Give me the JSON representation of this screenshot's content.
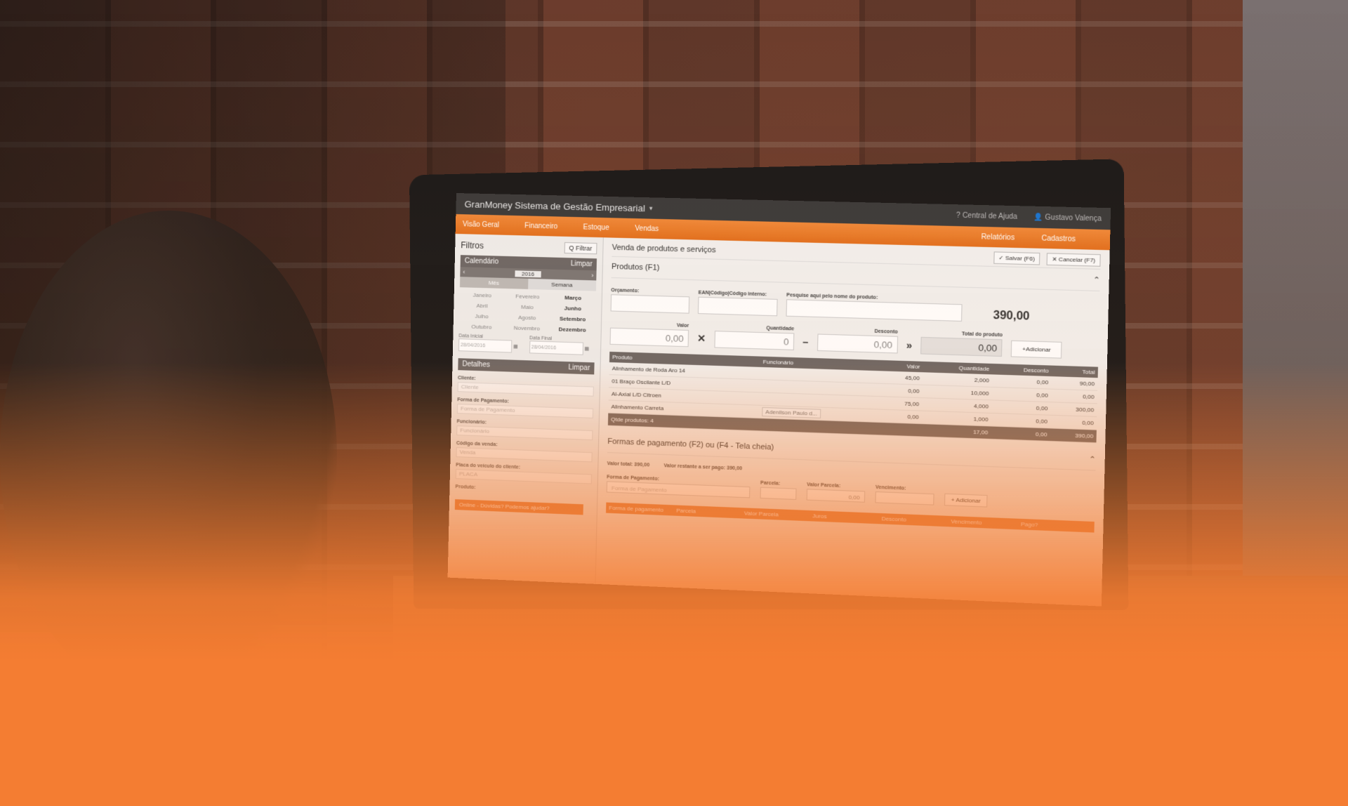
{
  "app": {
    "title": "GranMoney Sistema de Gestão Empresarial",
    "help": "? Central de Ajuda",
    "user": "Gustavo Valença"
  },
  "nav": {
    "items": [
      "Visão Geral",
      "Financeiro",
      "Estoque",
      "Vendas"
    ],
    "right_items": [
      "Relatórios",
      "Cadastros"
    ]
  },
  "sidebar": {
    "title": "Filtros",
    "filter_button": "Q Filtrar",
    "calendar": {
      "title": "Calendário",
      "clear": "Limpar",
      "year": "2016",
      "tabs": [
        "Mês",
        "Semana"
      ],
      "months": [
        "Janeiro",
        "Fevereiro",
        "Março",
        "Abril",
        "Maio",
        "Junho",
        "Julho",
        "Agosto",
        "Setembro",
        "Outubro",
        "Novembro",
        "Dezembro"
      ],
      "current_month": "Março",
      "date_start_label": "Data Inicial",
      "date_start": "28/04/2016",
      "date_end_label": "Data Final",
      "date_end": "28/04/2016"
    },
    "details": {
      "title": "Detalhes",
      "clear": "Limpar",
      "fields": [
        {
          "label": "Cliente:",
          "placeholder": "Cliente"
        },
        {
          "label": "Forma de Pagamento:",
          "placeholder": "Forma de Pagamento"
        },
        {
          "label": "Funcionário:",
          "placeholder": "Funcionário"
        },
        {
          "label": "Código da venda:",
          "placeholder": "Venda"
        },
        {
          "label": "Placa do veículo do cliente:",
          "placeholder": "PLACA"
        },
        {
          "label": "Produto:",
          "placeholder": ""
        }
      ]
    },
    "chat": "Online - Dúvidas? Podemos ajudar?"
  },
  "main": {
    "title": "Venda de produtos e serviços",
    "save": "✓ Salvar (F6)",
    "cancel": "✕ Cancelar (F7)",
    "products_section": "Produtos (F1)",
    "labels": {
      "orcamento": "Orçamento:",
      "ean": "EAN|Código|Código interno:",
      "search": "Pesquise aqui pelo nome do produto:",
      "valor": "Valor",
      "quantidade": "Quantidade",
      "desconto": "Desconto",
      "total_produto": "Total do produto"
    },
    "grand_total": "390,00",
    "inputs": {
      "valor": "0,00",
      "quantidade": "0",
      "desconto": "0,00",
      "total": "0,00"
    },
    "add_button": "+Adicionar",
    "table": {
      "headers": [
        "Produto",
        "Funcionário",
        "Valor",
        "Quantidade",
        "Desconto",
        "Total"
      ],
      "rows": [
        {
          "produto": "Alinhamento de Roda Aro 14",
          "func": "",
          "valor": "45,00",
          "qtd": "2,000",
          "desc": "0,00",
          "total": "90,00"
        },
        {
          "produto": "01 Braço Oscilante L/D",
          "func": "",
          "valor": "0,00",
          "qtd": "10,000",
          "desc": "0,00",
          "total": "0,00"
        },
        {
          "produto": "Al-Axial L/D Citroen",
          "func": "",
          "valor": "75,00",
          "qtd": "4,000",
          "desc": "0,00",
          "total": "300,00"
        },
        {
          "produto": "Alinhamento Carreta",
          "func": "Adenilson Paulo d...",
          "valor": "0,00",
          "qtd": "1,000",
          "desc": "0,00",
          "total": "0,00"
        }
      ],
      "footer": {
        "label": "Qtde produtos: 4",
        "qtd": "17,00",
        "desc": "0,00",
        "total": "390,00"
      }
    },
    "payments": {
      "title": "Formas de pagamento (F2) ou (F4 - Tela cheia)",
      "valor_total": "Valor total: 390,00",
      "valor_restante": "Valor restante a ser pago: 390,00",
      "forma_label": "Forma de Pagamento:",
      "forma_placeholder": "Forma de Pagamento",
      "parcela_label": "Parcela:",
      "valor_parcela_label": "Valor Parcela:",
      "valor_parcela": "0,00",
      "vencimento_label": "Vencimento:",
      "add": "+ Adicionar",
      "table_headers": [
        "Forma de pagamento",
        "Parcela",
        "Valor Parcela",
        "Juros",
        "Desconto",
        "Vencimento",
        "Pago?"
      ]
    }
  },
  "colors": {
    "accent": "#f47d32",
    "nav": "#e2701f",
    "header_dark": "#3b3b3b"
  }
}
